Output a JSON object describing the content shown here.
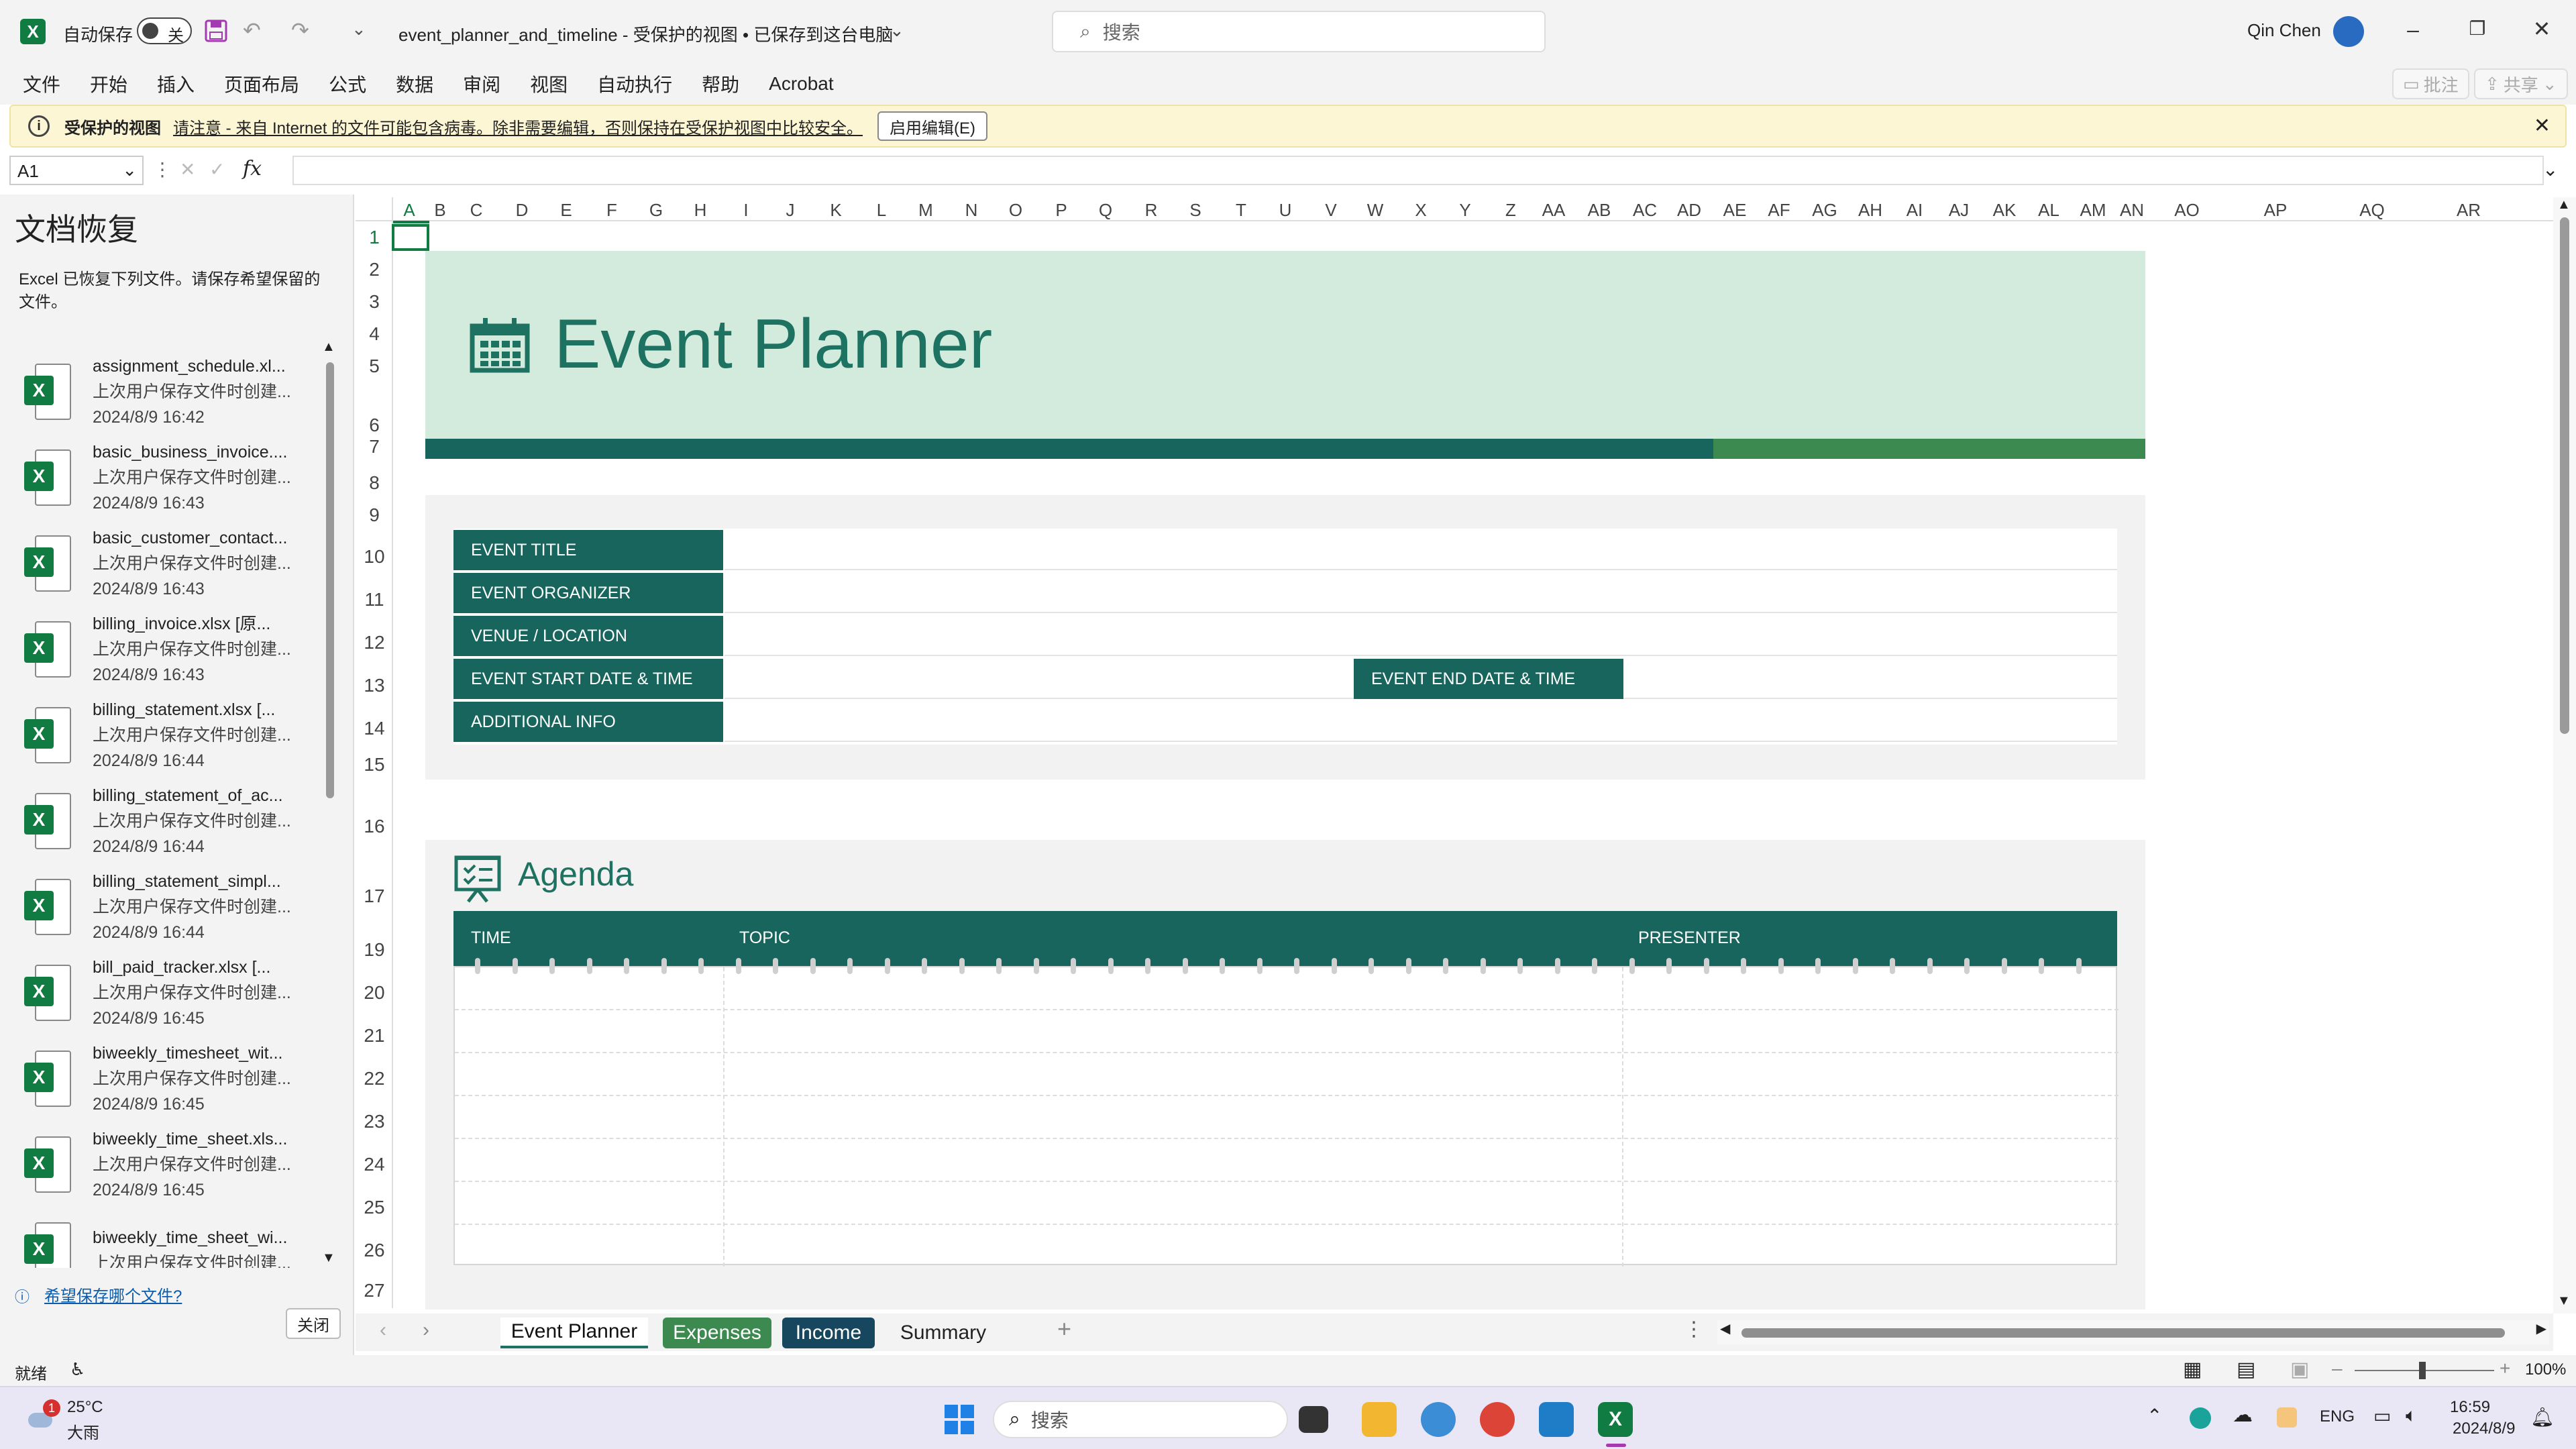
{
  "titlebar": {
    "autosave_label": "自动保存",
    "autosave_state": "关",
    "doc_title": "event_planner_and_timeline  -  受保护的视图 • 已保存到这台电脑",
    "search_placeholder": "搜索",
    "user_name": "Qin Chen"
  },
  "menu": {
    "items": [
      "文件",
      "开始",
      "插入",
      "页面布局",
      "公式",
      "数据",
      "审阅",
      "视图",
      "自动执行",
      "帮助",
      "Acrobat"
    ],
    "comments_label": "批注",
    "share_label": "共享"
  },
  "protected_view": {
    "label": "受保护的视图",
    "message": "请注意 - 来自 Internet 的文件可能包含病毒。除非需要编辑，否则保持在受保护视图中比较安全。",
    "enable_button": "启用编辑(E)"
  },
  "formula": {
    "name_box": "A1",
    "fx_label": "fx",
    "content": ""
  },
  "recovery": {
    "title": "文档恢复",
    "description": "Excel 已恢复下列文件。请保存希望保留的文件。",
    "files": [
      {
        "name": "assignment_schedule.xl...",
        "note": "上次用户保存文件时创建...",
        "time": "2024/8/9 16:42"
      },
      {
        "name": "basic_business_invoice....",
        "note": "上次用户保存文件时创建...",
        "time": "2024/8/9 16:43"
      },
      {
        "name": "basic_customer_contact...",
        "note": "上次用户保存文件时创建...",
        "time": "2024/8/9 16:43"
      },
      {
        "name": "billing_invoice.xlsx  [原...",
        "note": "上次用户保存文件时创建...",
        "time": "2024/8/9 16:43"
      },
      {
        "name": "billing_statement.xlsx  [...",
        "note": "上次用户保存文件时创建...",
        "time": "2024/8/9 16:44"
      },
      {
        "name": "billing_statement_of_ac...",
        "note": "上次用户保存文件时创建...",
        "time": "2024/8/9 16:44"
      },
      {
        "name": "billing_statement_simpl...",
        "note": "上次用户保存文件时创建...",
        "time": "2024/8/9 16:44"
      },
      {
        "name": "bill_paid_tracker.xlsx  [...",
        "note": "上次用户保存文件时创建...",
        "time": "2024/8/9 16:45"
      },
      {
        "name": "biweekly_timesheet_wit...",
        "note": "上次用户保存文件时创建...",
        "time": "2024/8/9 16:45"
      },
      {
        "name": "biweekly_time_sheet.xls...",
        "note": "上次用户保存文件时创建...",
        "time": "2024/8/9 16:45"
      },
      {
        "name": "biweekly_time_sheet_wi...",
        "note": "上次用户保存文件时创建...",
        "time": ""
      }
    ],
    "help_link": "希望保存哪个文件?",
    "close_button": "关闭"
  },
  "columns": [
    "A",
    "B",
    "C",
    "D",
    "E",
    "F",
    "G",
    "H",
    "I",
    "J",
    "K",
    "L",
    "M",
    "N",
    "O",
    "P",
    "Q",
    "R",
    "S",
    "T",
    "U",
    "V",
    "W",
    "X",
    "Y",
    "Z",
    "AA",
    "AB",
    "AC",
    "AD",
    "AE",
    "AF",
    "AG",
    "AH",
    "AI",
    "AJ",
    "AK",
    "AL",
    "AM",
    "AN",
    "AO",
    "AP",
    "AQ",
    "AR"
  ],
  "rows": [
    "1",
    "2",
    "3",
    "4",
    "5",
    "6",
    "7",
    "8",
    "9",
    "10",
    "11",
    "12",
    "13",
    "14",
    "15",
    "16",
    "17",
    "19",
    "20",
    "21",
    "22",
    "23",
    "24",
    "25",
    "26",
    "27"
  ],
  "sheet": {
    "banner_title": "Event Planner",
    "fields": [
      "EVENT TITLE",
      "EVENT ORGANIZER",
      "VENUE / LOCATION",
      "EVENT START DATE & TIME",
      "ADDITIONAL INFO"
    ],
    "end_field": "EVENT END DATE & TIME",
    "agenda_title": "Agenda",
    "agenda_cols": [
      "TIME",
      "TOPIC",
      "PRESENTER"
    ]
  },
  "tabs": [
    "Event Planner",
    "Expenses",
    "Income",
    "Summary"
  ],
  "status": {
    "ready": "就绪",
    "zoom": "100%"
  },
  "taskbar": {
    "weather_temp": "25°C",
    "weather_desc": "大雨",
    "weather_badge": "1",
    "search_placeholder": "搜索",
    "lang": "ENG",
    "time": "16:59",
    "date": "2024/8/9"
  }
}
